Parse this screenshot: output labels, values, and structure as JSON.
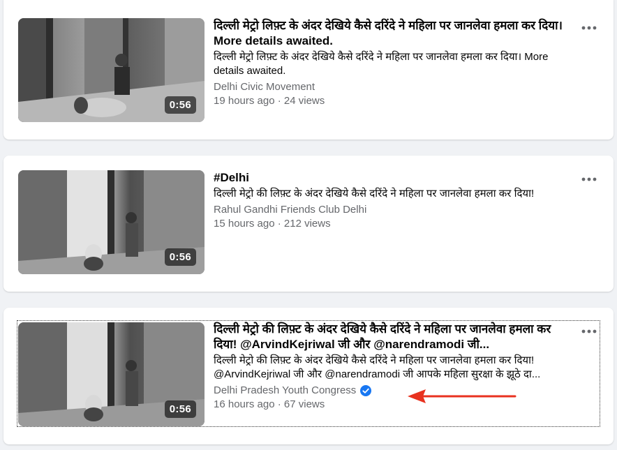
{
  "videos": [
    {
      "title": "दिल्ली मेट्रो लिफ़्ट के अंदर देखिये कैसे दरिंदे ने महिला पर जानलेवा हमला कर दिया। More details awaited.",
      "description": "दिल्ली मेट्रो लिफ़्ट के अंदर देखिये कैसे दरिंदे ने महिला पर जानलेवा हमला कर दिया। More details awaited.",
      "channel": "Delhi Civic Movement",
      "meta": "19 hours ago · 24 views",
      "duration": "0:56",
      "verified": false
    },
    {
      "title": "#Delhi",
      "description": "दिल्ली मेट्रो की लिफ़्ट के अंदर देखिये कैसे दरिंदे ने महिला पर जानलेवा हमला कर दिया!",
      "channel": "Rahul Gandhi Friends Club Delhi",
      "meta": "15 hours ago · 212 views",
      "duration": "0:56",
      "verified": false
    },
    {
      "title": "दिल्ली मेट्रो की लिफ़्ट के अंदर देखिये कैसे दरिंदे ने महिला पर जानलेवा हमला कर दिया! @ArvindKejriwal जी और @narendramodi जी...",
      "description": "दिल्ली मेट्रो की लिफ़्ट के अंदर देखिये कैसे दरिंदे ने महिला पर जानलेवा हमला कर दिया! @ArvindKejriwal जी और @narendramodi जी आपके महिला सुरक्षा के झूठे दा...",
      "channel": "Delhi Pradesh Youth Congress",
      "meta": "16 hours ago · 67 views",
      "duration": "0:56",
      "verified": true
    }
  ],
  "icons": {
    "more": "more-horizontal-icon",
    "verified": "verified-badge-icon",
    "annotation": "red-arrow-icon"
  },
  "colors": {
    "page_bg": "#f0f2f5",
    "card_bg": "#ffffff",
    "secondary_text": "#65676b",
    "verified_blue": "#1877f2",
    "annotation_red": "#e8321f"
  }
}
